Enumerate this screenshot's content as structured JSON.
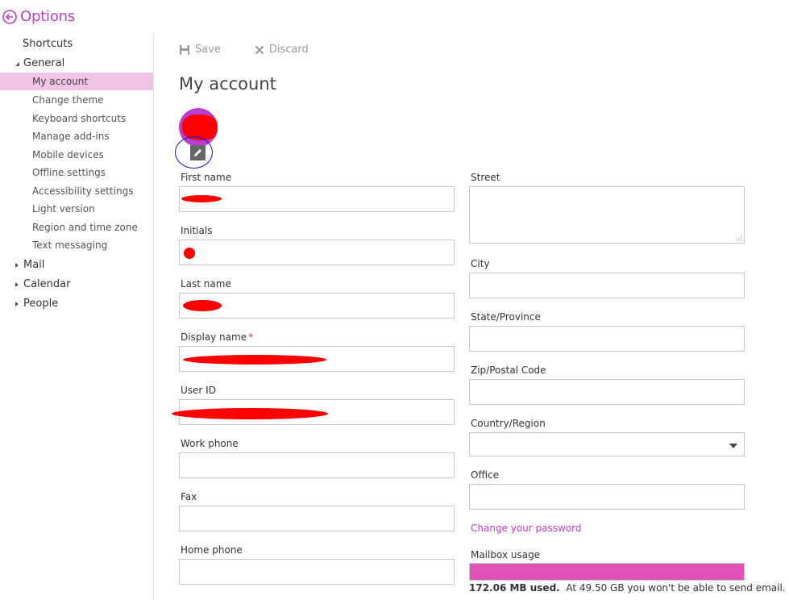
{
  "header": {
    "title": "Options",
    "back_icon": "back-arrow-circle-icon",
    "accent": "#c23ec2"
  },
  "sidebar": {
    "shortcuts": "Shortcuts",
    "general": {
      "label": "General",
      "items": [
        {
          "label": "My account",
          "active": true
        },
        {
          "label": "Change theme"
        },
        {
          "label": "Keyboard shortcuts"
        },
        {
          "label": "Manage add-ins"
        },
        {
          "label": "Mobile devices"
        },
        {
          "label": "Offline settings"
        },
        {
          "label": "Accessibility settings"
        },
        {
          "label": "Light version"
        },
        {
          "label": "Region and time zone"
        },
        {
          "label": "Text messaging"
        }
      ]
    },
    "mail": "Mail",
    "calendar": "Calendar",
    "people": "People",
    "active_color": "#f1c3e6"
  },
  "toolbar": {
    "save": "Save",
    "discard": "Discard"
  },
  "page": {
    "title": "My account"
  },
  "form": {
    "left": [
      {
        "label": "First name",
        "value": ""
      },
      {
        "label": "Initials",
        "value": ""
      },
      {
        "label": "Last name",
        "value": ""
      },
      {
        "label": "Display name",
        "value": ""
      },
      {
        "label": "User ID",
        "value": ""
      },
      {
        "label": "Work phone",
        "value": ""
      },
      {
        "label": "Fax",
        "value": ""
      },
      {
        "label": "Home phone",
        "value": ""
      }
    ],
    "right": [
      {
        "label": "Street",
        "value": ""
      },
      {
        "label": "City",
        "value": ""
      },
      {
        "label": "State/Province",
        "value": ""
      },
      {
        "label": "Zip/Postal Code",
        "value": ""
      },
      {
        "label": "Country/Region",
        "value": ""
      },
      {
        "label": "Office",
        "value": ""
      }
    ],
    "required_marker": "*"
  },
  "account": {
    "change_password": "Change your password",
    "mailbox_label": "Mailbox usage",
    "used": "172.06 MB used.",
    "limit_note": "At 49.50 GB you won't be able to send email.",
    "usage_fraction": 1.0,
    "usage_color": "#e152b8"
  }
}
